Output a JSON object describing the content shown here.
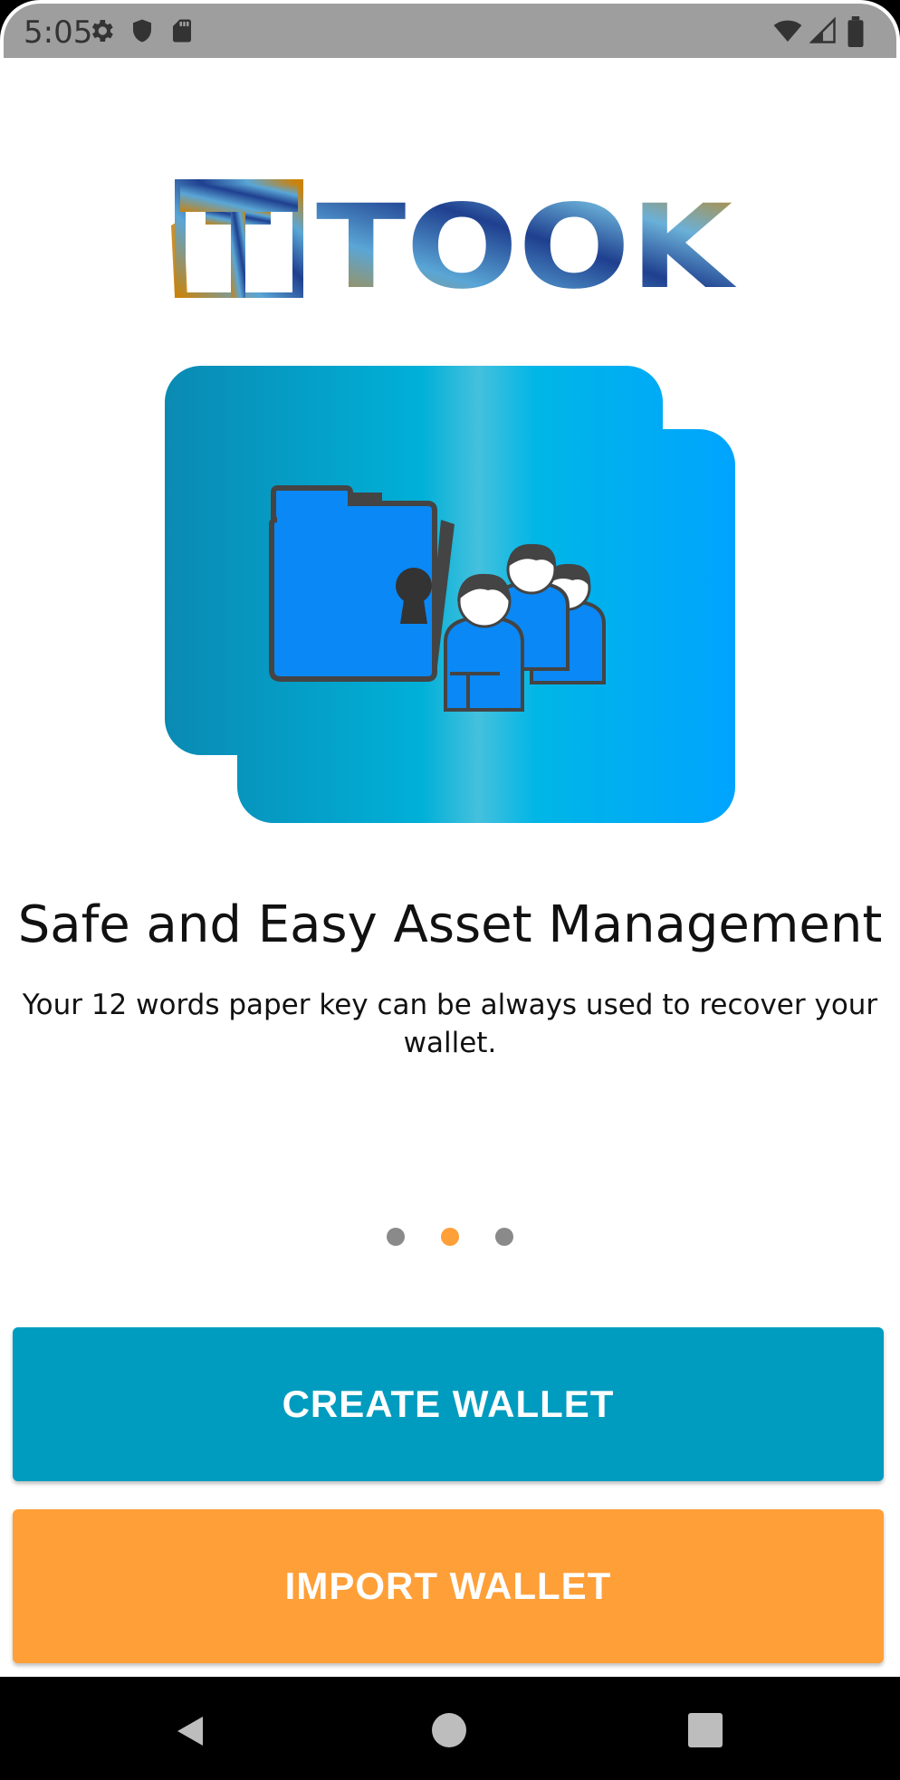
{
  "status_bar": {
    "time": "5:05",
    "icons": [
      "settings-gear-icon",
      "shield-icon",
      "sd-card-icon",
      "wifi-icon",
      "signal-icon",
      "battery-icon"
    ]
  },
  "brand": {
    "name": "TOOK"
  },
  "onboarding": {
    "title": "Safe and Easy Asset Management",
    "subtitle": "Your 12 words paper key can be always used to recover your wallet.",
    "pages": 3,
    "current_page": 2
  },
  "actions": {
    "create_label": "CREATE WALLET",
    "import_label": "IMPORT WALLET"
  },
  "colors": {
    "create_button": "#009cbf",
    "import_button": "#ff9f38",
    "active_dot": "#ff9f38",
    "inactive_dot": "#8a8a8a"
  },
  "nav_bar": {
    "icons": [
      "back-icon",
      "home-icon",
      "recents-icon"
    ]
  }
}
